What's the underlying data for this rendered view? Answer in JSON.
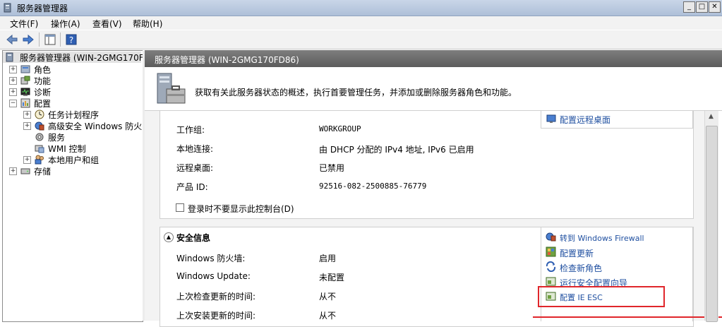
{
  "window": {
    "title": "服务器管理器"
  },
  "menu": [
    "文件(F)",
    "操作(A)",
    "查看(V)",
    "帮助(H)"
  ],
  "tree": {
    "root": "服务器管理器 (WIN-2GMG170FD8",
    "items": [
      {
        "label": "角色",
        "icon": "roles-icon"
      },
      {
        "label": "功能",
        "icon": "features-icon"
      },
      {
        "label": "诊断",
        "icon": "diagnostics-icon"
      },
      {
        "label": "配置",
        "icon": "configuration-icon"
      },
      {
        "label": "任务计划程序",
        "icon": "task-scheduler-icon"
      },
      {
        "label": "高级安全 Windows 防火",
        "icon": "firewall-icon"
      },
      {
        "label": "服务",
        "icon": "services-icon"
      },
      {
        "label": "WMI 控制",
        "icon": "wmi-icon"
      },
      {
        "label": "本地用户和组",
        "icon": "users-icon"
      },
      {
        "label": "存储",
        "icon": "storage-icon"
      }
    ]
  },
  "pane": {
    "header": "服务器管理器 (WIN-2GMG170FD86)",
    "banner": "获取有关此服务器状态的概述，执行首要管理任务，并添加或删除服务器角色和功能。"
  },
  "computer_info": {
    "rows": [
      {
        "label": "工作组:",
        "value": "WORKGROUP"
      },
      {
        "label": "本地连接:",
        "value": "由 DHCP 分配的 IPv4 地址, IPv6 已启用"
      },
      {
        "label": "远程桌面:",
        "value": "已禁用"
      },
      {
        "label": "产品 ID:",
        "value": "92516-082-2500885-76779"
      }
    ],
    "checkbox_label": "登录时不要显示此控制台(D)",
    "link": "配置远程桌面"
  },
  "security": {
    "title": "安全信息",
    "rows": [
      {
        "label": "Windows 防火墙:",
        "value": "启用"
      },
      {
        "label": "Windows Update:",
        "value": "未配置"
      },
      {
        "label": "上次检查更新的时间:",
        "value": "从不"
      },
      {
        "label": "上次安装更新的时间:",
        "value": "从不"
      }
    ],
    "links": [
      "转到 Windows Firewall",
      "配置更新",
      "检查新角色",
      "运行安全配置向导",
      "配置 IE ESC"
    ]
  },
  "colors": {
    "highlight": "#e0262b",
    "link": "#1f4fa0"
  }
}
